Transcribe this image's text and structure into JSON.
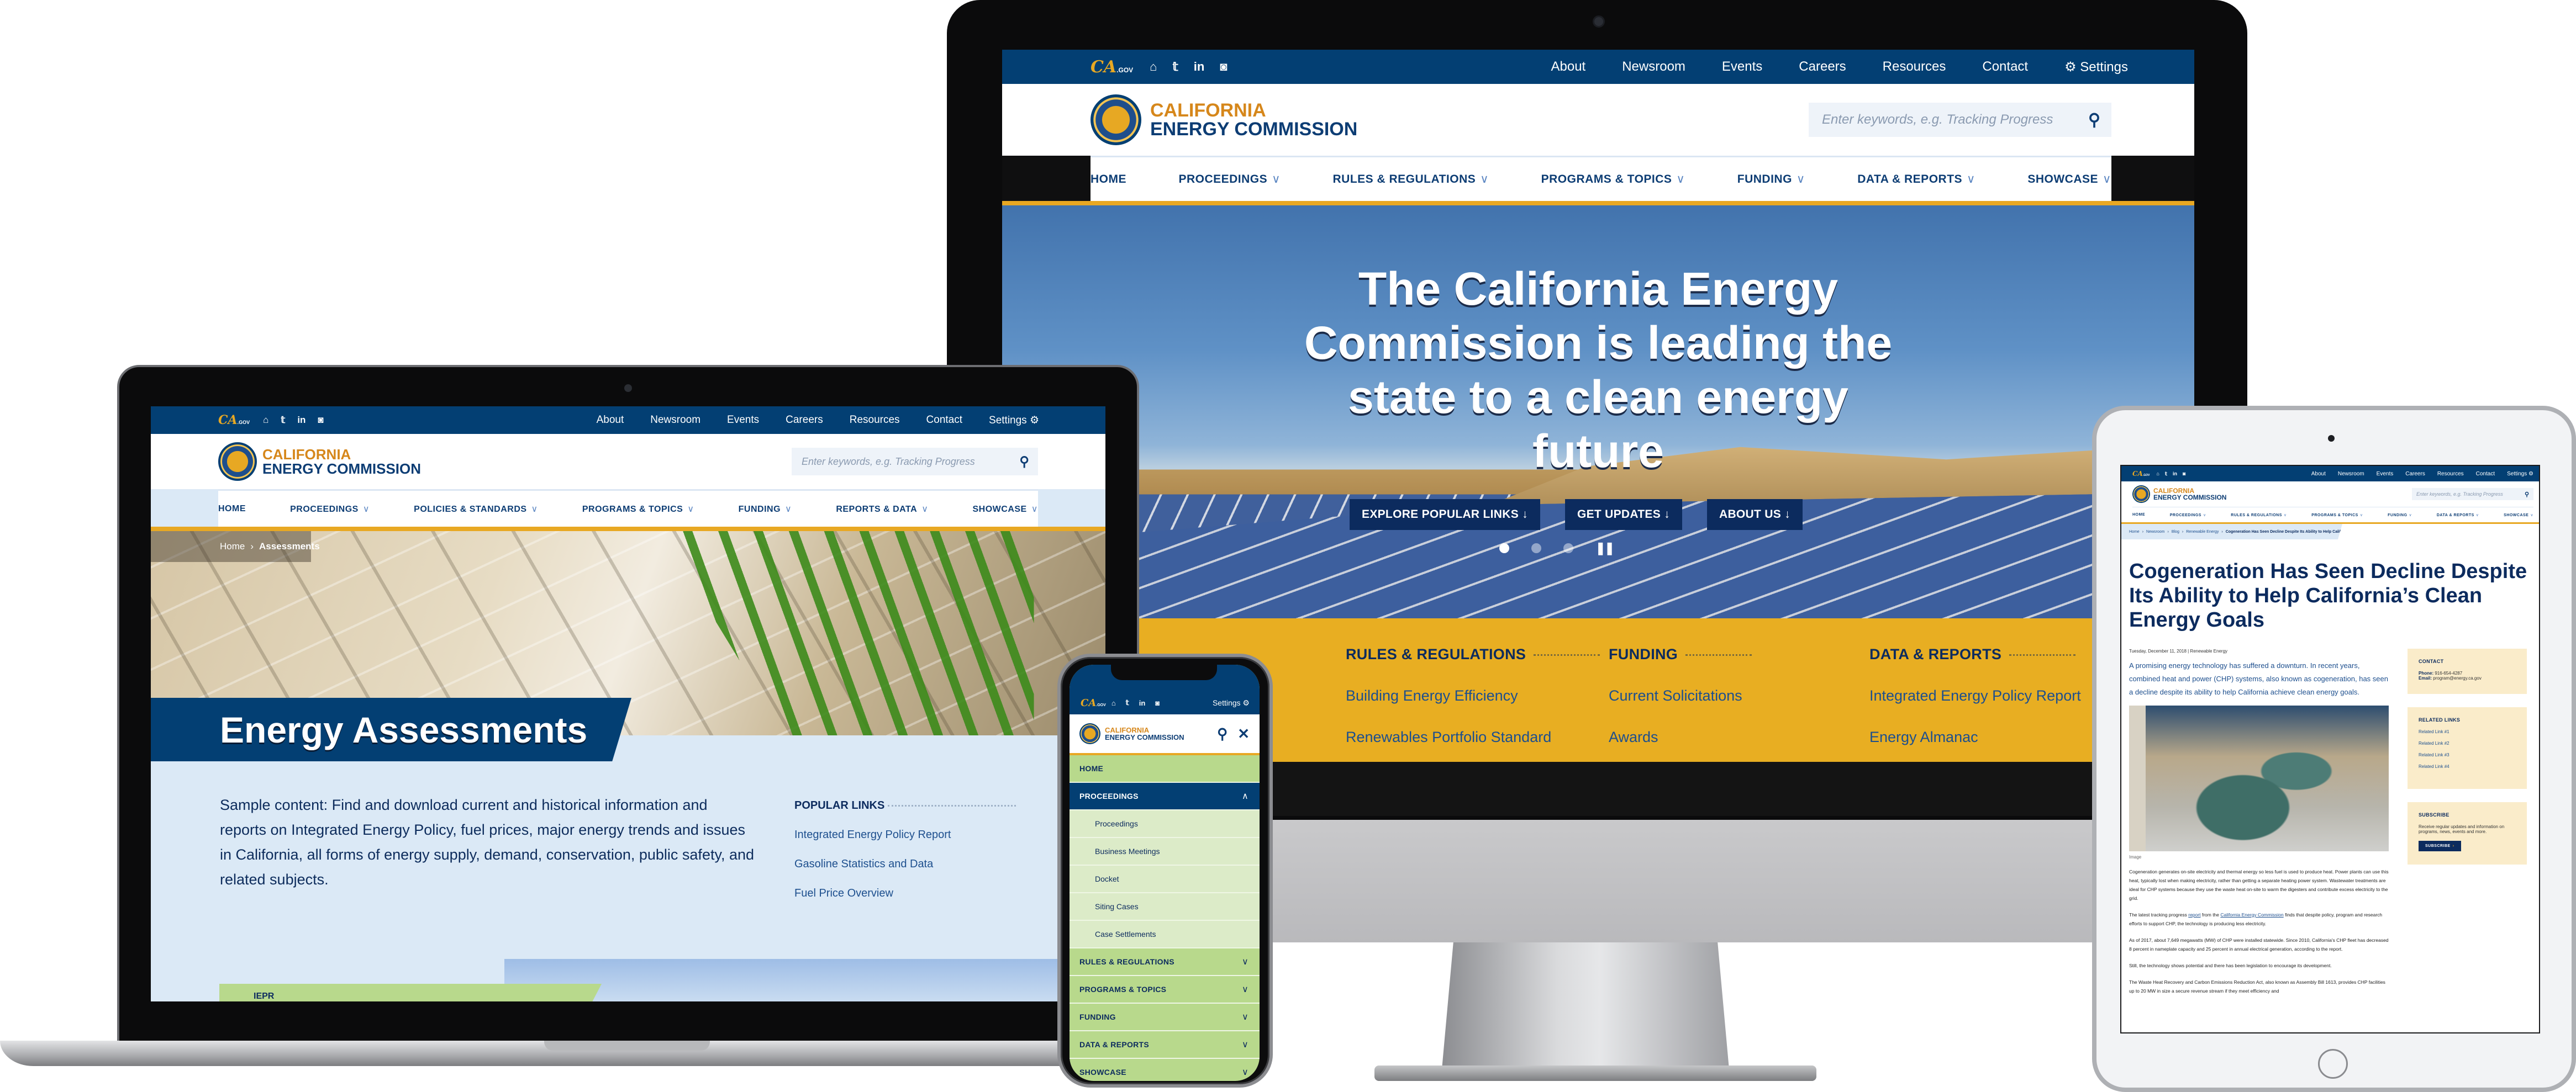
{
  "site": {
    "cagov": "CA",
    "cagov_suffix": ".GOV",
    "logo_line1": "CALIFORNIA",
    "logo_line2": "ENERGY COMMISSION",
    "search_placeholder": "Enter keywords, e.g. Tracking Progress",
    "social_icons": [
      "home-icon",
      "twitter-icon",
      "linkedin-icon",
      "instagram-icon"
    ],
    "util_links": [
      "About",
      "Newsroom",
      "Events",
      "Careers",
      "Resources",
      "Contact"
    ],
    "settings_label": "Settings",
    "colors": {
      "navy": "#033f73",
      "gold": "#e8a823",
      "orange_logo": "#d6871b",
      "green": "#b8d98c",
      "light_green": "#dcebc8",
      "cream": "#faecca"
    }
  },
  "monitor": {
    "nav": [
      "HOME",
      "PROCEEDINGS",
      "RULES & REGULATIONS",
      "PROGRAMS & TOPICS",
      "FUNDING",
      "DATA & REPORTS",
      "SHOWCASE"
    ],
    "hero_title": "The California Energy Commission is leading the state to a clean energy future",
    "cta": [
      "EXPLORE POPULAR LINKS ↓",
      "GET UPDATES ↓",
      "ABOUT US ↓"
    ],
    "slider": {
      "slides": 3,
      "active": 1,
      "pause_label": "pause"
    },
    "quick_links": [
      {
        "heading": "RULES & REGULATIONS",
        "links": [
          "Building Energy Efficiency",
          "Renewables Portfolio Standard"
        ]
      },
      {
        "heading": "FUNDING",
        "links": [
          "Current Solicitations",
          "Awards"
        ]
      },
      {
        "heading": "DATA & REPORTS",
        "links": [
          "Integrated Energy Policy Report",
          "Energy Almanac"
        ]
      }
    ]
  },
  "laptop": {
    "nav": [
      "HOME",
      "PROCEEDINGS",
      "POLICIES & STANDARDS",
      "PROGRAMS & TOPICS",
      "FUNDING",
      "REPORTS & DATA",
      "SHOWCASE"
    ],
    "breadcrumb": [
      "Home",
      "Assessments"
    ],
    "page_title": "Energy Assessments",
    "intro": "Sample content: Find and download current and historical information and reports on Integrated Energy Policy, fuel prices, major energy trends and issues in California, all forms of energy supply, demand, conservation, public safety, and related subjects.",
    "popular_links": {
      "heading": "POPULAR LINKS",
      "links": [
        "Integrated Energy Policy Report",
        "Gasoline Statistics and Data",
        "Fuel Price Overview"
      ]
    },
    "card_label": "IEPR"
  },
  "phone": {
    "menu": [
      {
        "label": "HOME",
        "type": "home"
      },
      {
        "label": "PROCEEDINGS",
        "type": "open"
      },
      {
        "label": "Proceedings",
        "type": "sub"
      },
      {
        "label": "Business Meetings",
        "type": "sub"
      },
      {
        "label": "Docket",
        "type": "sub"
      },
      {
        "label": "Siting Cases",
        "type": "sub"
      },
      {
        "label": "Case Settlements",
        "type": "sub"
      },
      {
        "label": "RULES & REGULATIONS",
        "type": "closed"
      },
      {
        "label": "PROGRAMS & TOPICS",
        "type": "closed"
      },
      {
        "label": "FUNDING",
        "type": "closed"
      },
      {
        "label": "DATA & REPORTS",
        "type": "closed"
      },
      {
        "label": "SHOWCASE",
        "type": "closed"
      }
    ]
  },
  "tablet": {
    "nav": [
      "HOME",
      "PROCEEDINGS",
      "RULES & REGULATIONS",
      "PROGRAMS & TOPICS",
      "FUNDING",
      "DATA & REPORTS",
      "SHOWCASE"
    ],
    "breadcrumb": [
      "Home",
      "Newsroom",
      "Blog",
      "Renewable Energy",
      "Cogeneration Has Seen Decline Despite Its Ability to Help California's Clean Energy Goals"
    ],
    "title": "Cogeneration Has Seen Decline Despite Its Ability to Help California’s Clean Energy Goals",
    "date_line": "Tuesday, December 11, 2018 | Renewable Energy",
    "lead": "A promising energy technology has suffered a downturn. In recent years, combined heat and power (CHP) systems, also known as cogeneration, has seen a decline despite its ability to help California achieve clean energy goals.",
    "image_caption": "Image",
    "para1": "Cogeneration generates on-site electricity and thermal energy so less fuel is used to produce heat. Power plants can use this heat, typically lost when making electricity, rather than getting a separate heating power system. Wastewater treatments are ideal for CHP systems because they use the waste heat on-site to warm the digesters and contribute excess electricity to the grid.",
    "para2_before": "The latest tracking progress ",
    "para2_link1": "report",
    "para2_mid": " from the ",
    "para2_link2": "California Energy Commission",
    "para2_after": " finds that despite policy, program and research efforts to support CHP, the technology is producing less electricity.",
    "para3": "As of 2017, about 7,649 megawatts (MW) of CHP were installed statewide. Since 2010, California's CHP fleet has decreased 8 percent in nameplate capacity and 25 percent in annual electrical generation, according to the report.",
    "para4": "Still, the technology shows potential and there has been legislation to encourage its development.",
    "para5": "The Waste Heat Recovery and Carbon Emissions Reduction Act, also known as Assembly Bill 1613, provides CHP facilities up to 20 MW in size a secure revenue stream if they meet efficiency and",
    "contact": {
      "heading": "CONTACT",
      "phone_label": "Phone:",
      "phone": "916-654-4287",
      "email_label": "Email:",
      "email": "program@energy.ca.gov"
    },
    "related": {
      "heading": "RELATED LINKS",
      "links": [
        "Related Link #1",
        "Related Link #2",
        "Related Link #3",
        "Related Link #4"
      ]
    },
    "subscribe": {
      "heading": "SUBSCRIBE",
      "text": "Receive regular updates and information on programs, news, events and more.",
      "button": "SUBSCRIBE"
    }
  }
}
